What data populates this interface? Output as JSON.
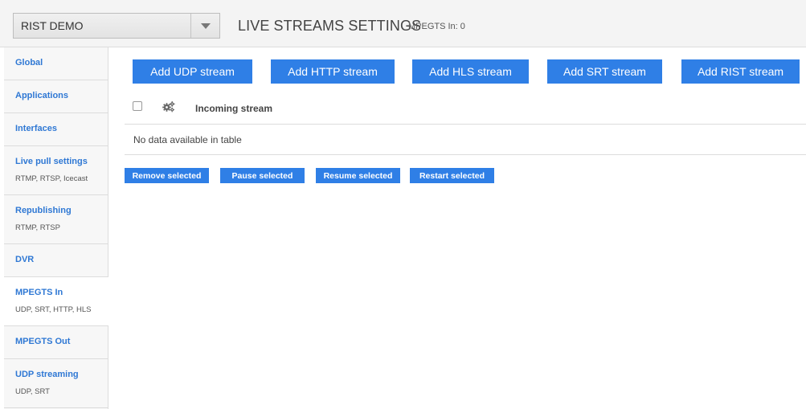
{
  "header": {
    "app_select_value": "RIST DEMO",
    "page_title": "LIVE STREAMS SETTINGS",
    "page_subtitle": "MPEGTS In: 0"
  },
  "sidebar": {
    "items": [
      {
        "label": "Global",
        "sub": ""
      },
      {
        "label": "Applications",
        "sub": ""
      },
      {
        "label": "Interfaces",
        "sub": ""
      },
      {
        "label": "Live pull settings",
        "sub": "RTMP, RTSP, Icecast"
      },
      {
        "label": "Republishing",
        "sub": "RTMP, RTSP"
      },
      {
        "label": "DVR",
        "sub": ""
      },
      {
        "label": "MPEGTS In",
        "sub": "UDP, SRT, HTTP, HLS",
        "active": true
      },
      {
        "label": "MPEGTS Out",
        "sub": ""
      },
      {
        "label": "UDP streaming",
        "sub": "UDP, SRT"
      }
    ]
  },
  "toolbar": {
    "add_udp": "Add UDP stream",
    "add_http": "Add HTTP stream",
    "add_hls": "Add HLS stream",
    "add_srt": "Add SRT stream",
    "add_rist": "Add RIST stream"
  },
  "table": {
    "columns": [
      "",
      "",
      "Incoming stream"
    ],
    "empty_text": "No data available in table"
  },
  "actions": {
    "remove": "Remove selected",
    "pause": "Pause selected",
    "resume": "Resume selected",
    "restart": "Restart selected"
  },
  "icons": {
    "dropdown": "chevron-down-icon",
    "settings": "gears-icon"
  },
  "colors": {
    "accent": "#2f7fe6",
    "link": "#2f78d4"
  }
}
